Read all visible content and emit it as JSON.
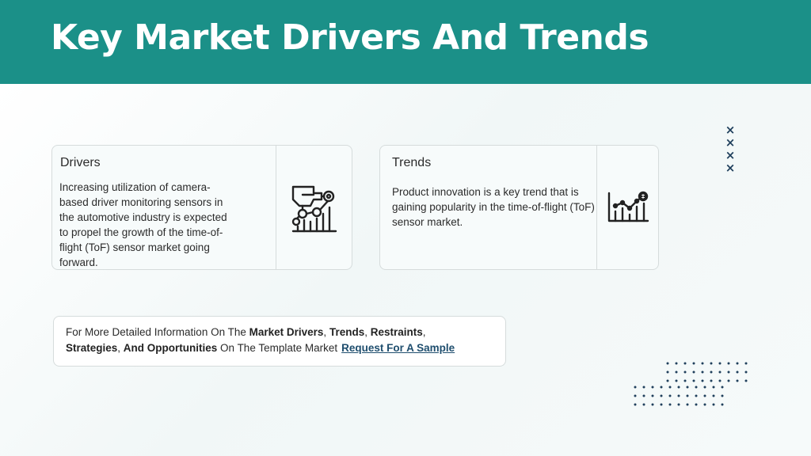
{
  "header": {
    "title": "Key Market Drivers And Trends"
  },
  "drivers": {
    "title": "Drivers",
    "text": "Increasing utilization of camera-based driver monitoring sensors in the automotive industry is expected to propel the growth of the time-of-flight (ToF) sensor market going forward.",
    "icon": "robotic-hand-icon"
  },
  "trends": {
    "title": "Trends",
    "text": "Product innovation is a key trend that is gaining popularity in the time-of-flight (ToF) sensor market.",
    "icon": "growth-chart-icon"
  },
  "decor": {
    "cross_marks": [
      "×",
      "×",
      "×",
      "×"
    ]
  },
  "info": {
    "t1": "For More Detailed Information On The ",
    "b1": "Market Drivers",
    "s1": ", ",
    "b2": "Trends",
    "s2": ", ",
    "b3": "Restraints",
    "s3": ", ",
    "b4": "Strategies",
    "s4": ", ",
    "b5": "And Opportunities",
    "t2": " On The Template Market",
    "link": "Request For A Sample"
  },
  "colors": {
    "header_bg": "#1b9088",
    "header_text": "#ffffff",
    "link": "#1f4e6e",
    "accent_dark": "#1f3f5c"
  }
}
